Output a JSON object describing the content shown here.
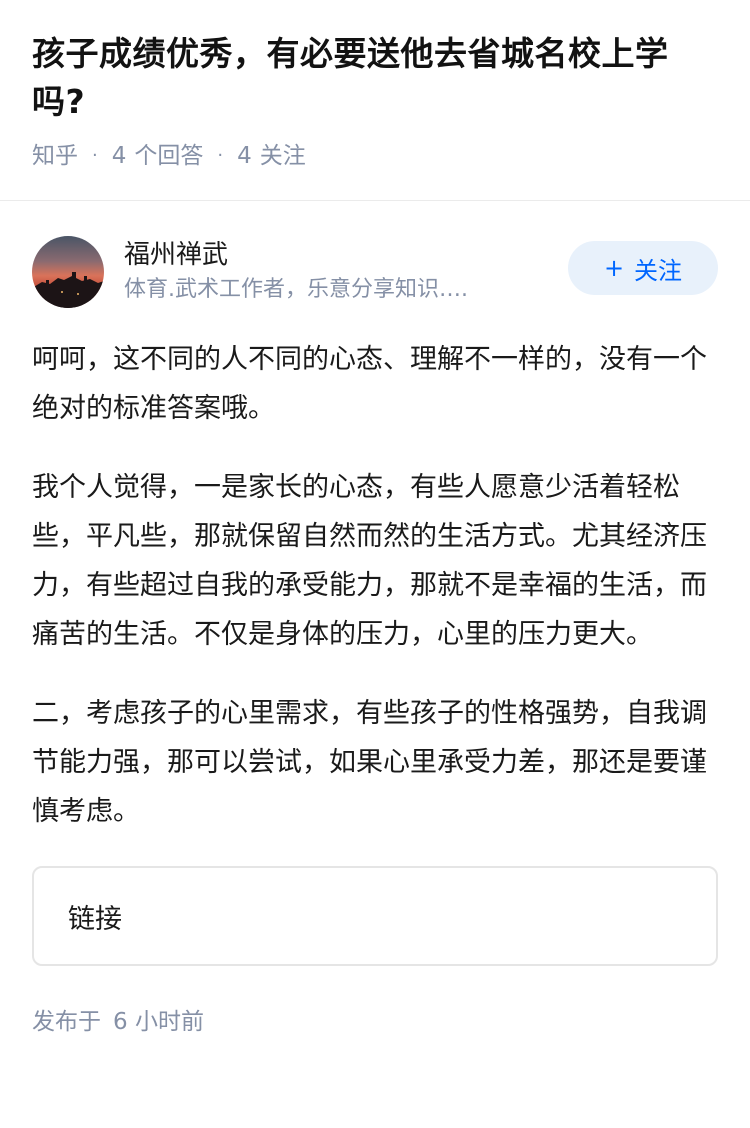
{
  "question": {
    "title": "孩子成绩优秀，有必要送他去省城名校上学吗?",
    "source": "知乎",
    "answer_count": "4",
    "answer_label": "个回答",
    "follow_count": "4",
    "follow_label": "关注"
  },
  "answer": {
    "author": {
      "name": "福州禅武",
      "bio": "体育.武术工作者，乐意分享知识….",
      "follow_button": "关注",
      "avatar_icon": "sunset-landscape-avatar"
    },
    "paragraphs": [
      "呵呵，这不同的人不同的心态、理解不一样的，没有一个绝对的标准答案哦。",
      "我个人觉得，一是家长的心态，有些人愿意少活着轻松些，平凡些，那就保留自然而然的生活方式。尤其经济压力，有些超过自我的承受能力，那就不是幸福的生活，而痛苦的生活。不仅是身体的压力，心里的压力更大。",
      "二，考虑孩子的心里需求，有些孩子的性格强势，自我调节能力强，那可以尝试，如果心里承受力差，那还是要谨慎考虑。"
    ],
    "link_label": "链接",
    "publish_prefix": "发布于",
    "publish_time": "6 小时前"
  },
  "colors": {
    "accent": "#0066ff",
    "follow_bg": "#e8f1fb",
    "meta_gray": "#8590a6"
  }
}
